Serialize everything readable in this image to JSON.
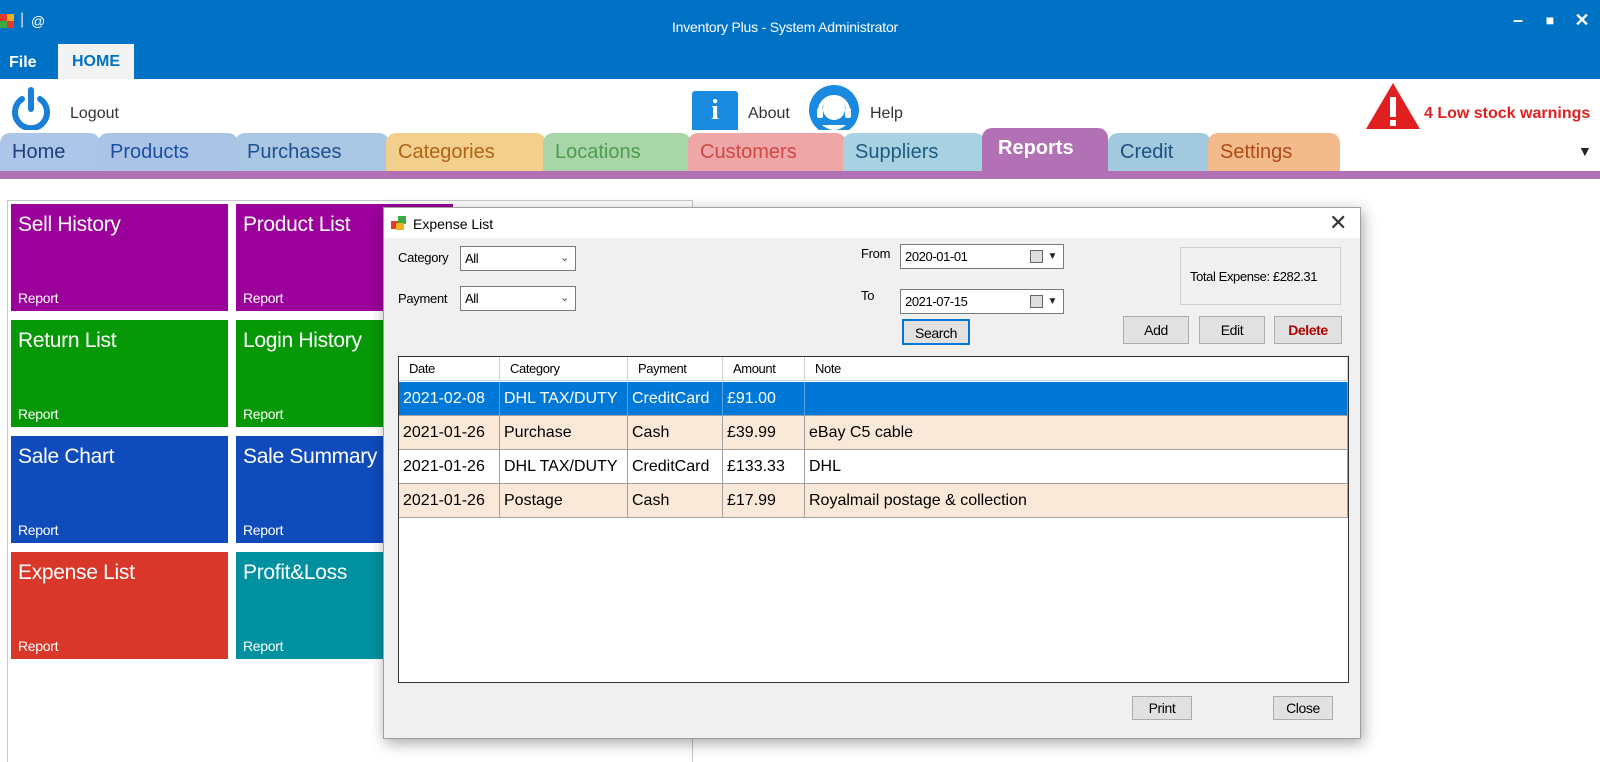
{
  "window": {
    "title": "Inventory Plus - System Administrator",
    "separator": "|",
    "at_symbol": "@",
    "minimize": "–",
    "maximize": "■",
    "close": "✕"
  },
  "ribbon": {
    "file_tab": "File",
    "home_tab": "HOME"
  },
  "toolbar": {
    "logout_label": "Logout",
    "about_label": "About",
    "about_icon_glyph": "i",
    "help_label": "Help",
    "warning_text": "4 Low stock warnings"
  },
  "nav": {
    "tabs": [
      {
        "label": "Home",
        "bg": "#abc6e8",
        "color": "#1e3f7a"
      },
      {
        "label": "Products",
        "bg": "#a9c4e6",
        "color": "#1e4fa0"
      },
      {
        "label": "Purchases",
        "bg": "#a9c7e2",
        "color": "#1e4f90"
      },
      {
        "label": "Categories",
        "bg": "#f2cf8a",
        "color": "#b0651a"
      },
      {
        "label": "Locations",
        "bg": "#a8d6a8",
        "color": "#4f9a4f"
      },
      {
        "label": "Customers",
        "bg": "#efa6a6",
        "color": "#d04848"
      },
      {
        "label": "Suppliers",
        "bg": "#a8d2e2",
        "color": "#1e5a80"
      },
      {
        "label": "Reports",
        "bg": "#b271b4",
        "color": "#ffffff"
      },
      {
        "label": "Credit",
        "bg": "#a3c9df",
        "color": "#1e4f80"
      },
      {
        "label": "Settings",
        "bg": "#f3bb8c",
        "color": "#b04a1a"
      }
    ],
    "dropdown_glyph": "▼"
  },
  "tiles": [
    {
      "title": "Sell History",
      "sub": "Report",
      "color": "#9b009b"
    },
    {
      "title": "Product List",
      "sub": "Report",
      "color": "#9b009b"
    },
    {
      "title": "Return List",
      "sub": "Report",
      "color": "#079807"
    },
    {
      "title": "Login History",
      "sub": "Report",
      "color": "#079807"
    },
    {
      "title": "Sale Chart",
      "sub": "Report",
      "color": "#0f4bbb"
    },
    {
      "title": "Sale Summary",
      "sub": "Report",
      "color": "#0f4bbb"
    },
    {
      "title": "Expense List",
      "sub": "Report",
      "color": "#d9372a"
    },
    {
      "title": "Profit&Loss",
      "sub": "Report",
      "color": "#00909f"
    }
  ],
  "dialog": {
    "title": "Expense List",
    "close_glyph": "✕",
    "category_label": "Category",
    "category_value": "All",
    "payment_label": "Payment",
    "payment_value": "All",
    "from_label": "From",
    "from_value": "2020-01-01",
    "to_label": "To",
    "to_value": "2021-07-15",
    "search_label": "Search",
    "total_expense": "Total Expense: £282.31",
    "add_label": "Add",
    "edit_label": "Edit",
    "delete_label": "Delete",
    "print_label": "Print",
    "close_label": "Close",
    "combo_chevron": "⌄",
    "date_chevron": "▼",
    "grid": {
      "columns": [
        "Date",
        "Category",
        "Payment",
        "Amount",
        "Note"
      ],
      "rows": [
        {
          "date": "2021-02-08",
          "category": "DHL TAX/DUTY",
          "payment": "CreditCard",
          "amount": "£91.00",
          "note": "",
          "selected": true
        },
        {
          "date": "2021-01-26",
          "category": "Purchase",
          "payment": "Cash",
          "amount": "£39.99",
          "note": "eBay C5 cable",
          "selected": false
        },
        {
          "date": "2021-01-26",
          "category": "DHL TAX/DUTY",
          "payment": "CreditCard",
          "amount": "£133.33",
          "note": "DHL",
          "selected": false
        },
        {
          "date": "2021-01-26",
          "category": "Postage",
          "payment": "Cash",
          "amount": "£17.99",
          "note": "Royalmail postage & collection",
          "selected": false
        }
      ]
    }
  },
  "colors": {
    "titlebar": "#0072c6",
    "selected_row": "#0078d7",
    "alt_row": "#fae8d8",
    "warning": "#e02020"
  }
}
